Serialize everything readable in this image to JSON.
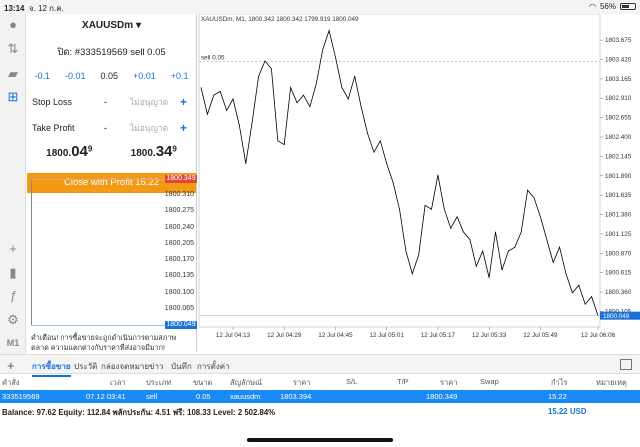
{
  "status_bar": {
    "time": "13:14",
    "date": "จ. 12 ก.ค.",
    "battery": "56%",
    "battery_level": 0.56
  },
  "toolbar": {
    "timeframe": "M1"
  },
  "order": {
    "symbol": "XAUUSDm",
    "ticket": "ปิด: #333519569 sell 0.05",
    "steps": [
      "-0.1",
      "-0.01",
      "0.05",
      "+0.01",
      "+0.1"
    ],
    "stop_loss": {
      "label": "Stop Loss",
      "placeholder": "ไม่อนุญาต"
    },
    "take_profit": {
      "label": "Take Profit",
      "placeholder": "ไม่อนุญาต"
    },
    "bid": {
      "main": "1800.",
      "big": "04",
      "sup": "9"
    },
    "ask": {
      "main": "1800.",
      "big": "34",
      "sup": "9"
    },
    "close_label": "Close with Profit 15.22",
    "depth_labels": [
      "1800.349",
      "1800.310",
      "1800.275",
      "1800.240",
      "1800.205",
      "1800.170",
      "1800.135",
      "1800.100",
      "1800.065",
      "1800.049"
    ],
    "warning": "คำเตือน! การซื้อขายจะถูกดำเนินการตามสภาพตลาด ความแตกต่างกับราคาที่ส่งอาจมีมาก!",
    "colors": {
      "ask": "#e0463a",
      "bid": "#1a72d9",
      "button": "#f29a13"
    }
  },
  "chart_data": {
    "type": "line",
    "title": "XAUUSDm, M1, 1800.342 1800.342 1799.919 1800.049",
    "sell_line_label": "sell 0.05",
    "sell_level": 1803.394,
    "current_bid": 1800.049,
    "ylim": [
      1799.9,
      1803.9
    ],
    "y_ticks": [
      "1803.675",
      "1803.420",
      "1803.165",
      "1802.910",
      "1802.655",
      "1802.400",
      "1802.145",
      "1801.890",
      "1801.635",
      "1801.380",
      "1801.125",
      "1800.870",
      "1800.615",
      "1800.360",
      "1800.105"
    ],
    "x_ticks": [
      "12 Jul 04:13",
      "12 Jul 04:29",
      "12 Jul 04:45",
      "12 Jul 05:01",
      "12 Jul 05:17",
      "12 Jul 05:33",
      "12 Jul 05:49",
      "12 Jul 06:06"
    ],
    "x": [
      "04:03",
      "04:05",
      "04:07",
      "04:09",
      "04:11",
      "04:13",
      "04:15",
      "04:17",
      "04:19",
      "04:21",
      "04:23",
      "04:25",
      "04:27",
      "04:29",
      "04:31",
      "04:33",
      "04:35",
      "04:37",
      "04:39",
      "04:41",
      "04:43",
      "04:45",
      "04:47",
      "04:49",
      "04:51",
      "04:53",
      "04:55",
      "04:57",
      "04:59",
      "05:01",
      "05:03",
      "05:05",
      "05:07",
      "05:09",
      "05:11",
      "05:13",
      "05:15",
      "05:17",
      "05:19",
      "05:21",
      "05:23",
      "05:25",
      "05:27",
      "05:29",
      "05:31",
      "05:33",
      "05:35",
      "05:37",
      "05:39",
      "05:41",
      "05:43",
      "05:45",
      "05:47",
      "05:49",
      "05:51",
      "05:53",
      "05:55",
      "05:57",
      "05:59",
      "06:01",
      "06:03",
      "06:05",
      "06:06"
    ],
    "values": [
      1803.05,
      1802.7,
      1802.95,
      1803.0,
      1802.75,
      1802.9,
      1802.55,
      1802.05,
      1802.6,
      1803.2,
      1803.4,
      1803.3,
      1802.35,
      1802.3,
      1803.05,
      1802.85,
      1802.95,
      1802.8,
      1803.1,
      1803.55,
      1803.8,
      1803.45,
      1803.05,
      1802.9,
      1803.2,
      1802.8,
      1802.45,
      1802.2,
      1802.35,
      1802.05,
      1801.8,
      1801.45,
      1800.9,
      1800.6,
      1800.85,
      1801.5,
      1801.45,
      1801.9,
      1801.45,
      1801.2,
      1801.35,
      1801.15,
      1801.05,
      1800.7,
      1800.9,
      1800.55,
      1801.15,
      1800.65,
      1800.9,
      1800.95,
      1801.15,
      1801.7,
      1801.6,
      1801.35,
      1801.05,
      1800.75,
      1800.95,
      1800.6,
      1800.35,
      1800.45,
      1800.2,
      1800.3,
      1800.049
    ],
    "grid": false,
    "colors": {
      "line": "#000000",
      "sell_line": "#aaaaaa",
      "bid_tag": "#1a72d9"
    }
  },
  "tabs": [
    "การซื้อขาย",
    "ประวัติ",
    "กล่องจดหมาย",
    "ข่าว",
    "บันทึก",
    "การตั้งค่า"
  ],
  "table": {
    "headers": [
      "คำสั่ง",
      "เวลา",
      "ประเภท",
      "ขนาด",
      "สัญลักษณ์",
      "ราคา",
      "S/L",
      "T/P",
      "ราคา",
      "Swap",
      "กำไร",
      "หมายเหตุ"
    ],
    "row": [
      "333519569",
      "07.12 03:41",
      "sell",
      "0.05",
      "xauusdm",
      "1803.394",
      "",
      "",
      "1800.349",
      "",
      "15.22",
      ""
    ]
  },
  "summary": {
    "text": "Balance: 97.62 Equity: 112.84 พลักประกัน: 4.51 ฟรี: 108.33 Level: 2 502.84%",
    "profit": "15.22",
    "currency": "USD"
  }
}
